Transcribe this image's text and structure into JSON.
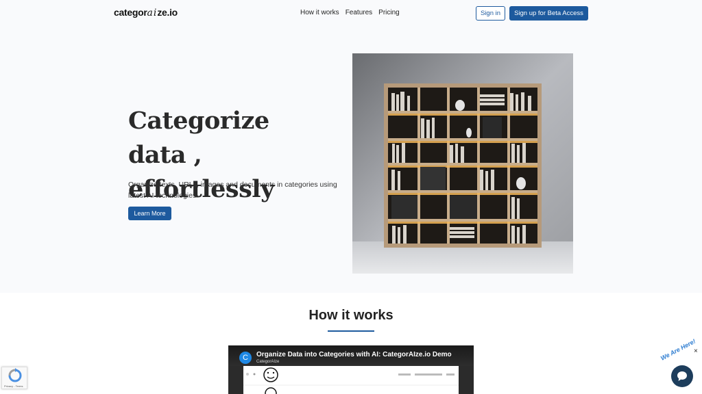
{
  "header": {
    "logo": {
      "prefix": "categor",
      "ai": "ai",
      "suffix": "ze.io"
    },
    "nav": [
      "How it works",
      "Features",
      "Pricing"
    ],
    "sign_in": "Sign in",
    "sign_up": "Sign up for Beta Access"
  },
  "hero": {
    "title_line1": "Categorize data ,",
    "title_line2": "effortlessly",
    "subtitle": "Organize texts, URLs, images and documents in categories using latest AI technologies",
    "cta": "Learn More"
  },
  "how": {
    "title": "How it works",
    "video": {
      "avatar": "C",
      "title": "Organize Data into Categories with AI: CategorAIze.io Demo",
      "channel": "CategorAIze"
    }
  },
  "widgets": {
    "recaptcha_text": "Privacy - Terms",
    "chat_tag": "We Are Here!",
    "chat_close": "×"
  },
  "colors": {
    "accent": "#1d5a9e",
    "hero_bg": "#f9fafc",
    "chat": "#1d3d5c"
  }
}
